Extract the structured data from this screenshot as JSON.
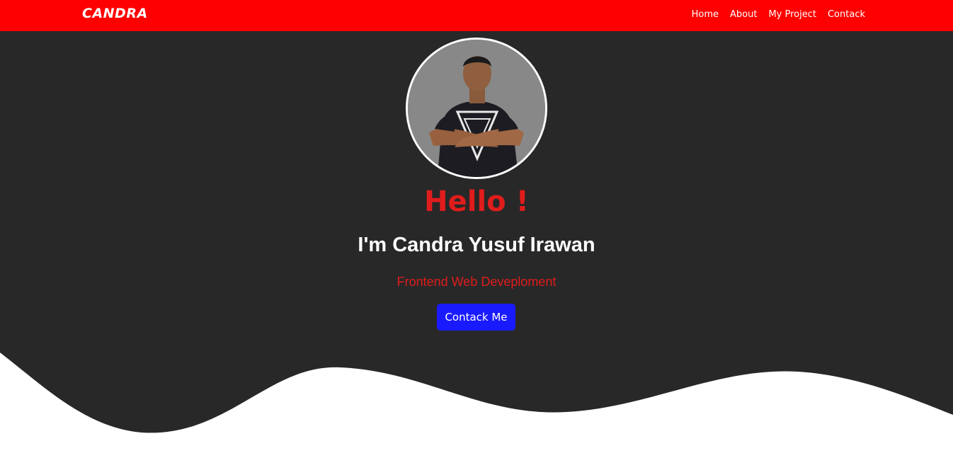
{
  "navbar": {
    "brand": "CANDRA",
    "links": [
      "Home",
      "About",
      "My Project",
      "Contack"
    ],
    "background": "#ff0000"
  },
  "hero": {
    "greeting": "Hello !",
    "name": "I'm Candra Yusuf Irawan",
    "role": "Frontend Web Deveploment",
    "cta_label": "Contack Me",
    "background": "#282828",
    "accent": "#e01c1c",
    "button_color": "#1a1aff"
  },
  "avatar": {
    "icon": "profile-photo"
  }
}
